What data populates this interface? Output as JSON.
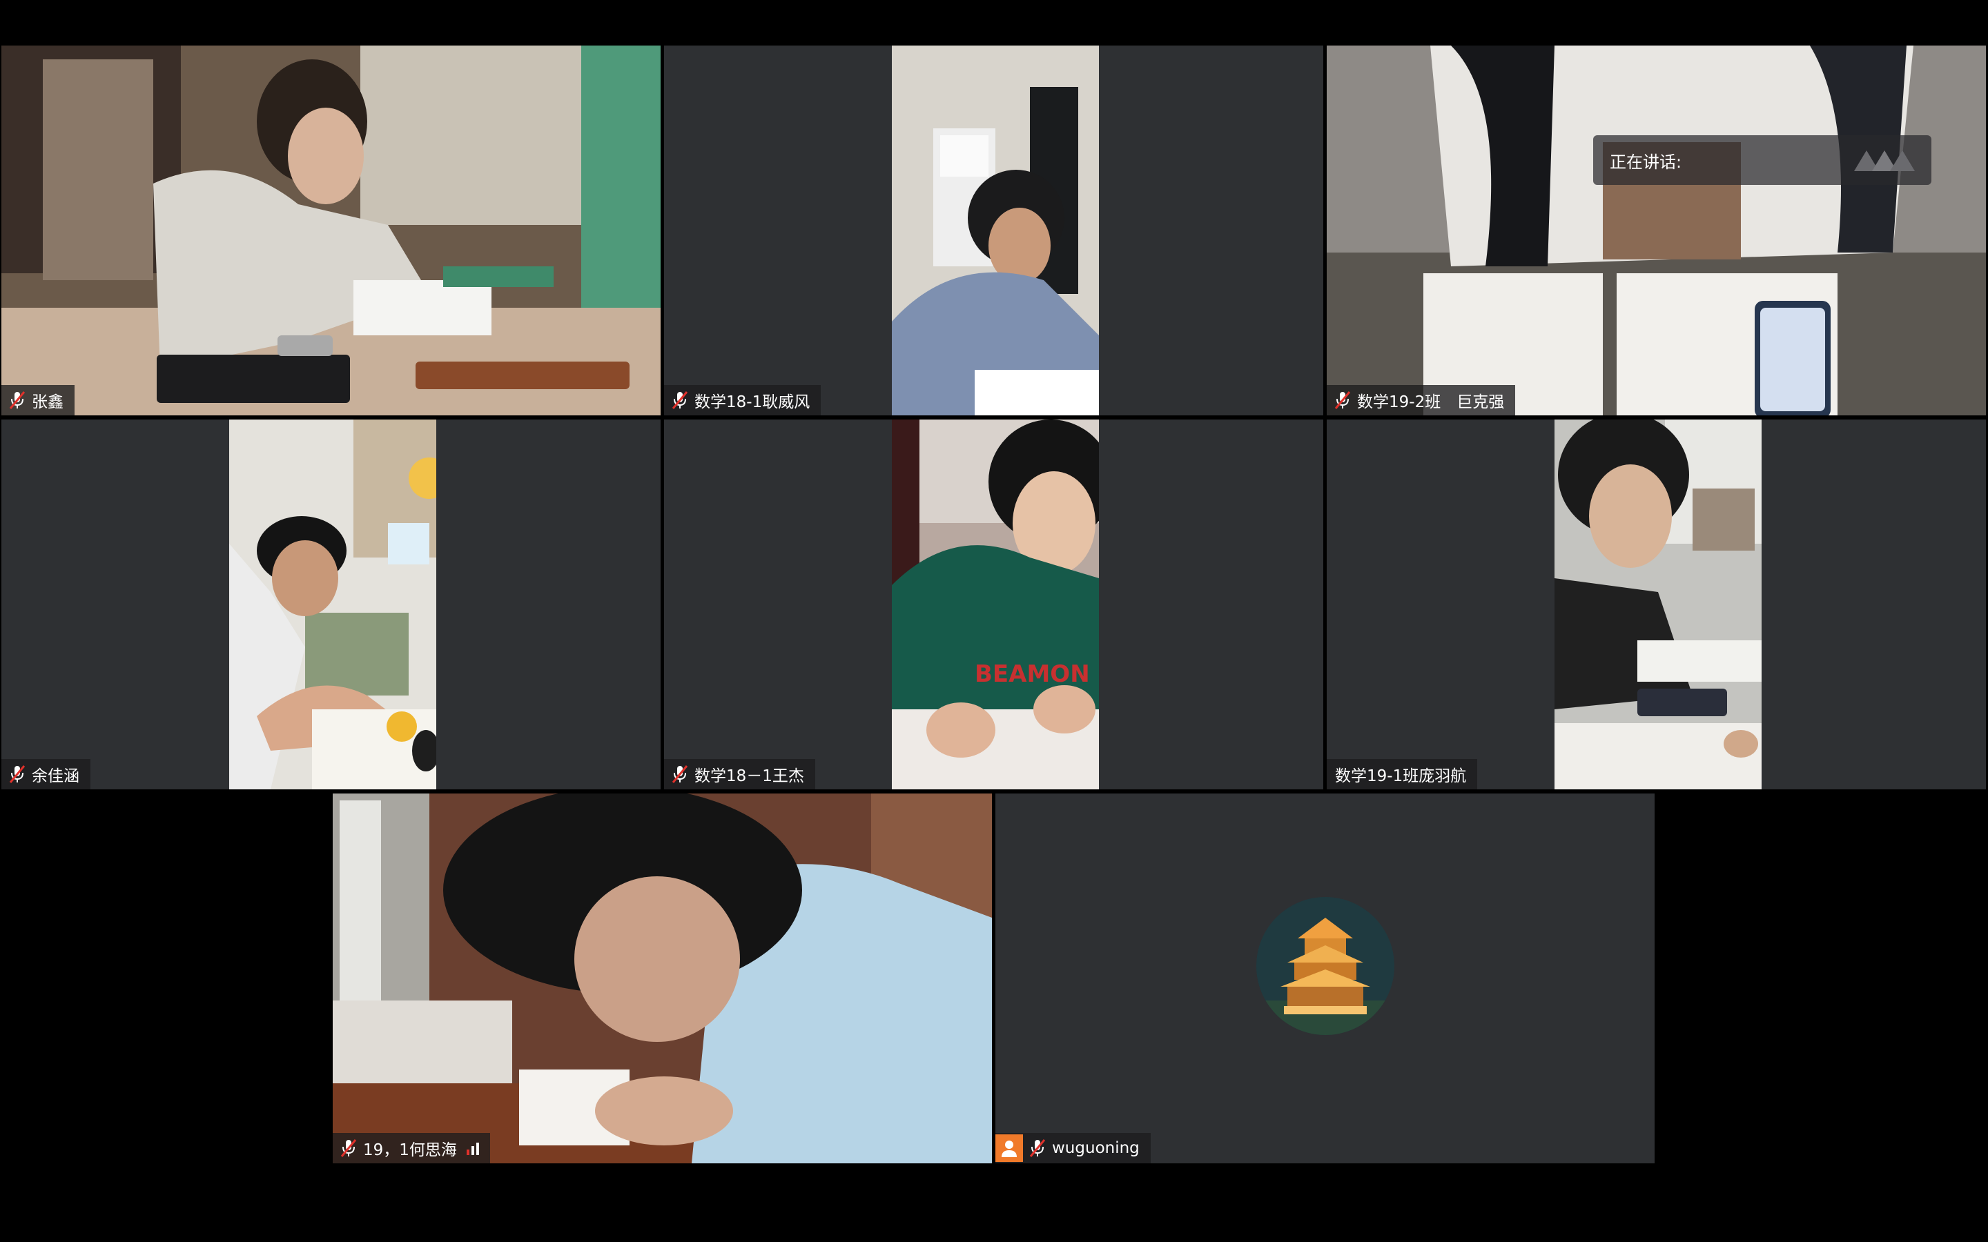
{
  "participants": [
    {
      "name": "张鑫",
      "muted": true
    },
    {
      "name": "数学18-1耿威风",
      "muted": true
    },
    {
      "name": "数学19-2班　巨克强",
      "muted": true
    },
    {
      "name": "余佳涵",
      "muted": true
    },
    {
      "name": "数学18－1王杰",
      "muted": true
    },
    {
      "name": "数学19-1班庞羽航",
      "muted": false
    },
    {
      "name": "19，1何思海",
      "muted": true,
      "signal_bars": 3
    },
    {
      "name": "wuguoning",
      "muted": true,
      "has_avatar_image": true,
      "avatar_color": "#f07a2a"
    }
  ],
  "speaking": {
    "label": "正在讲话:"
  },
  "colors": {
    "tile_bg": "#2e3033",
    "page_bg": "#000000",
    "accent": "#f07a2a",
    "mic_muted": "#e0312b"
  }
}
